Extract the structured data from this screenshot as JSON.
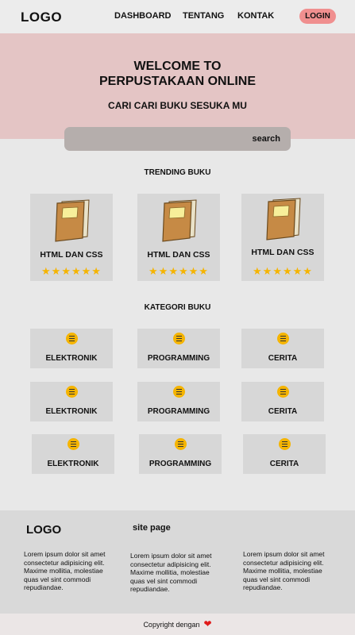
{
  "nav": {
    "logo": "LOGO",
    "links": [
      "DASHBOARD",
      "TENTANG",
      "KONTAK"
    ],
    "login": "LOGIN"
  },
  "hero": {
    "title_line1": "WELCOME TO",
    "title_line2": "PERPUSTAKAAN ONLINE",
    "subtitle": "CARI CARI BUKU SESUKA MU"
  },
  "search": {
    "label": "search"
  },
  "trending": {
    "title": "TRENDING BUKU",
    "books": [
      {
        "title": "HTML DAN CSS",
        "stars": "★★★★★★",
        "rating": 6
      },
      {
        "title": "HTML DAN CSS",
        "stars": "★★★★★★",
        "rating": 6
      },
      {
        "title": "HTML DAN CSS",
        "stars": "★★★★★★",
        "rating": 6
      }
    ]
  },
  "categories": {
    "title": "KATEGORI BUKU",
    "items": [
      "ELEKTRONIK",
      "PROGRAMMING",
      "CERITA",
      "ELEKTRONIK",
      "PROGRAMMING",
      "CERITA",
      "ELEKTRONIK",
      "PROGRAMMING",
      "CERITA"
    ]
  },
  "footer": {
    "logo": "LOGO",
    "site_page": "site page",
    "col1_text": "Lorem ipsum dolor sit amet consectetur adipisicing elit. Maxime mollitia, molestiae quas vel sint commodi repudiandae.",
    "col2_text": "Lorem ipsum dolor sit amet consectetur adipisicing elit. Maxime mollitia, molestiae quas vel sint commodi repudiandae.",
    "col3_text": "Lorem ipsum dolor sit amet consectetur adipisicing elit. Maxime mollitia, molestiae quas vel sint commodi repudiandae."
  },
  "copyright": {
    "text": "Copyright dengan",
    "icon": "heart-icon"
  },
  "colors": {
    "hero_bg": "#e4c5c5",
    "login_bg": "#f08f8f",
    "search_bg": "#b5aeac",
    "star": "#f5b400",
    "heart": "#e01b1b"
  }
}
